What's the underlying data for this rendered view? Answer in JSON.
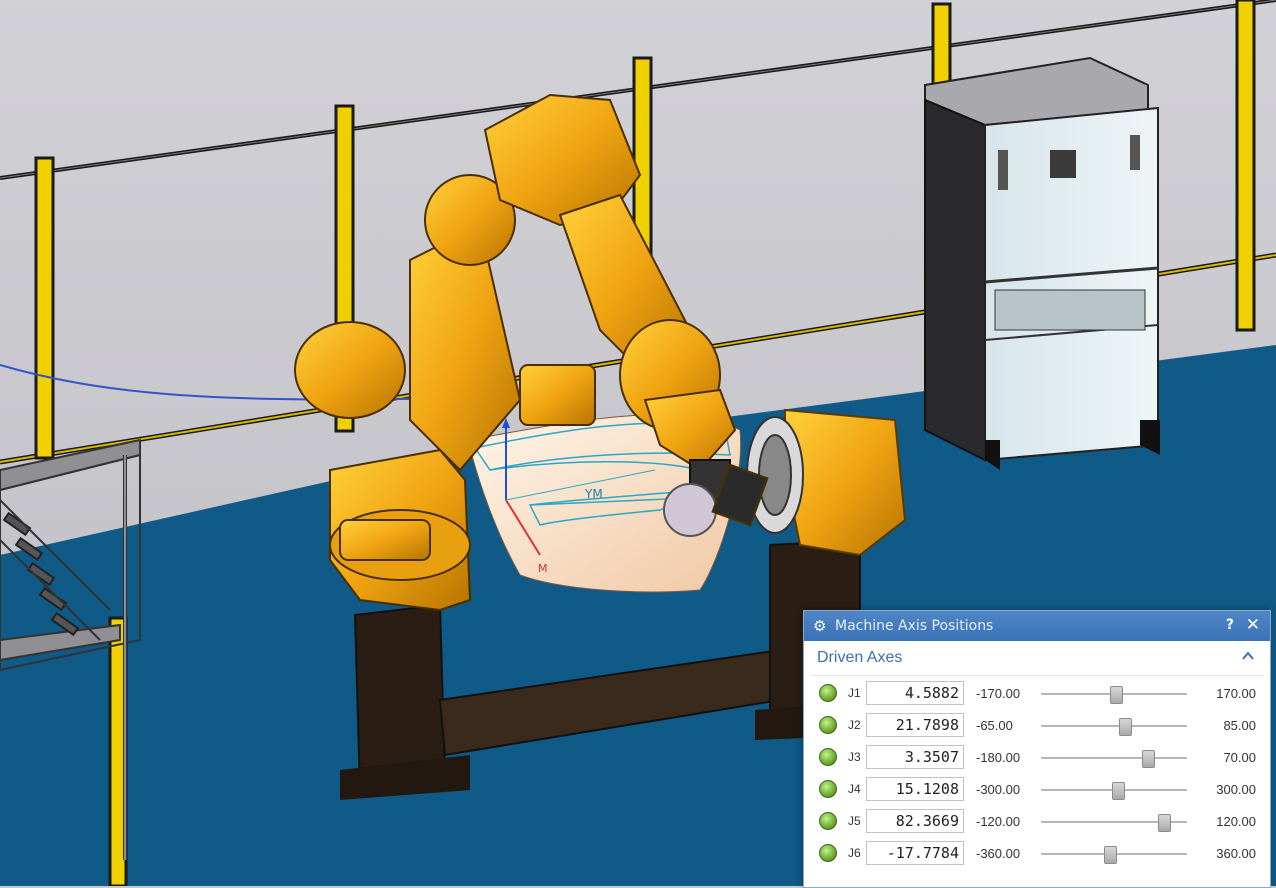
{
  "viewport": {
    "csys_label": "YM",
    "csys_small_label": "M"
  },
  "dialog": {
    "title": "Machine Axis Positions",
    "help_label": "?",
    "close_label": "✕",
    "section_title": "Driven Axes",
    "axes": [
      {
        "name": "J1",
        "value": "4.5882",
        "min": "-170.00",
        "max": "170.00",
        "position": 4.5882,
        "min_num": -170,
        "max_num": 170
      },
      {
        "name": "J2",
        "value": "21.7898",
        "min": "-65.00",
        "max": "85.00",
        "position": 21.7898,
        "min_num": -65,
        "max_num": 85
      },
      {
        "name": "J3",
        "value": "3.3507",
        "min": "-180.00",
        "max": "70.00",
        "position": 3.3507,
        "min_num": -180,
        "max_num": 70
      },
      {
        "name": "J4",
        "value": "15.1208",
        "min": "-300.00",
        "max": "300.00",
        "position": 15.1208,
        "min_num": -300,
        "max_num": 300
      },
      {
        "name": "J5",
        "value": "82.3669",
        "min": "-120.00",
        "max": "120.00",
        "position": 82.3669,
        "min_num": -120,
        "max_num": 120
      },
      {
        "name": "J6",
        "value": "-17.7784",
        "min": "-360.00",
        "max": "360.00",
        "position": -17.7784,
        "min_num": -360,
        "max_num": 360
      }
    ]
  },
  "colors": {
    "floor": "#0f5a86",
    "wall": "#c8c7cc",
    "robot": "#f0a412",
    "fence_post": "#f0d000",
    "titlebar": "#3f79bc",
    "section_title": "#3a6fb4"
  }
}
